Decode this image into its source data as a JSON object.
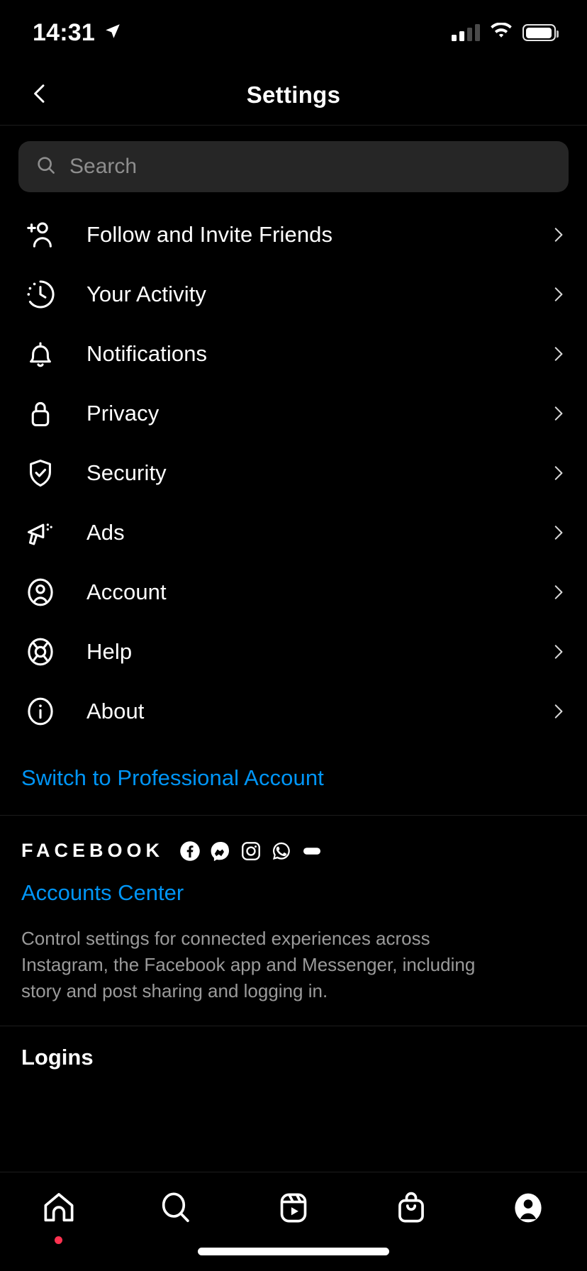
{
  "status_bar": {
    "time": "14:31",
    "location_icon": "location-arrow-icon",
    "signal_icon": "cellular-signal-icon",
    "wifi_icon": "wifi-icon",
    "battery_icon": "battery-icon"
  },
  "nav": {
    "back_icon": "chevron-left-icon",
    "title": "Settings"
  },
  "search": {
    "icon": "search-icon",
    "placeholder": "Search",
    "value": ""
  },
  "menu": {
    "items": [
      {
        "label": "Follow and Invite Friends",
        "icon": "person-add-icon"
      },
      {
        "label": "Your Activity",
        "icon": "activity-clock-icon"
      },
      {
        "label": "Notifications",
        "icon": "bell-icon"
      },
      {
        "label": "Privacy",
        "icon": "lock-icon"
      },
      {
        "label": "Security",
        "icon": "shield-check-icon"
      },
      {
        "label": "Ads",
        "icon": "megaphone-icon"
      },
      {
        "label": "Account",
        "icon": "account-circle-icon"
      },
      {
        "label": "Help",
        "icon": "life-ring-icon"
      },
      {
        "label": "About",
        "icon": "info-circle-icon"
      }
    ],
    "chevron_icon": "chevron-right-icon"
  },
  "professional": {
    "label": "Switch to Professional Account"
  },
  "facebook": {
    "wordmark": "FACEBOOK",
    "apps": [
      {
        "name": "facebook-icon"
      },
      {
        "name": "messenger-icon"
      },
      {
        "name": "instagram-icon"
      },
      {
        "name": "whatsapp-icon"
      },
      {
        "name": "oculus-icon"
      }
    ],
    "accounts_center": "Accounts Center",
    "description": "Control settings for connected experiences across Instagram, the Facebook app and Messenger, including story and post sharing and logging in."
  },
  "logins": {
    "title": "Logins"
  },
  "tab_bar": {
    "tabs": [
      {
        "name": "home-tab",
        "icon": "home-icon",
        "badge": true
      },
      {
        "name": "search-tab",
        "icon": "search-icon",
        "badge": false
      },
      {
        "name": "reels-tab",
        "icon": "reels-icon",
        "badge": false
      },
      {
        "name": "shop-tab",
        "icon": "shopping-bag-icon",
        "badge": false
      },
      {
        "name": "profile-tab",
        "icon": "profile-avatar-icon",
        "badge": false
      }
    ]
  },
  "colors": {
    "background": "#000000",
    "link": "#0095f6",
    "text": "#ffffff",
    "muted": "#9a9a9a",
    "search_bg": "#262626",
    "divider": "#1c1c1c",
    "badge": "#ff3250"
  }
}
